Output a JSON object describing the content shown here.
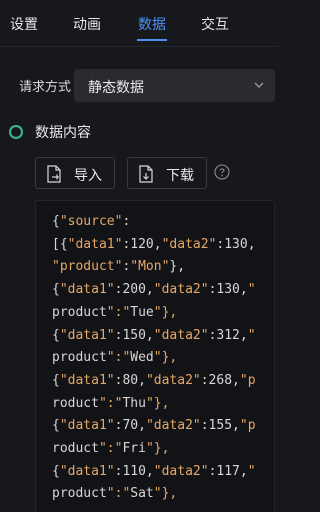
{
  "tabs": [
    {
      "label": "设置"
    },
    {
      "label": "动画"
    },
    {
      "label": "数据"
    },
    {
      "label": "交互"
    }
  ],
  "active_tab": "数据",
  "request": {
    "label": "请求方式",
    "selected": "静态数据"
  },
  "section": {
    "title": "数据内容"
  },
  "buttons": {
    "import_label": "导入",
    "download_label": "下载"
  },
  "code_lines": [
    "{\"source\":",
    "[{\"data1\":120,\"data2\":130,",
    "\"product\":\"Mon\"},",
    "{\"data1\":200,\"data2\":130,\"",
    "product\":\"Tue\"},",
    "{\"data1\":150,\"data2\":312,\"",
    "product\":\"Wed\"},",
    "{\"data1\":80,\"data2\":268,\"p",
    "roduct\":\"Thu\"},",
    "{\"data1\":70,\"data2\":155,\"p",
    "roduct\":\"Fri\"},",
    "{\"data1\":110,\"data2\":117,\"",
    "product\":\"Sat\"},"
  ],
  "colors": {
    "background": "#17181c",
    "accent": "#4d8ff5",
    "section_dot": "#3bb79b",
    "string": "#e6a766"
  }
}
